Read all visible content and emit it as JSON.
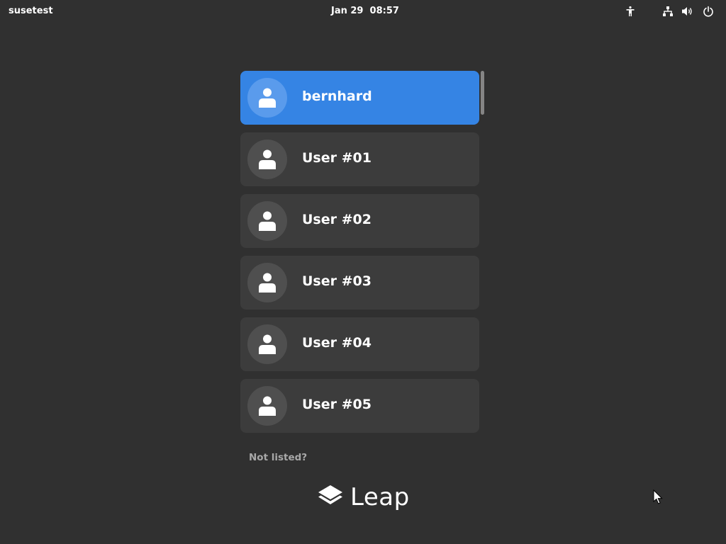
{
  "topbar": {
    "hostname": "susetest",
    "clock": "Jan 29  08:57",
    "indicators": [
      "accessibility-icon",
      "network-wired-icon",
      "volume-icon",
      "power-icon"
    ]
  },
  "users": [
    {
      "name": "bernhard",
      "selected": true
    },
    {
      "name": "User #01",
      "selected": false
    },
    {
      "name": "User #02",
      "selected": false
    },
    {
      "name": "User #03",
      "selected": false
    },
    {
      "name": "User #04",
      "selected": false
    },
    {
      "name": "User #05",
      "selected": false
    }
  ],
  "not_listed_label": "Not listed?",
  "logo": {
    "icon": "leap-layers-icon",
    "text": "Leap"
  },
  "colors": {
    "background": "#303030",
    "selected": "#3584e4",
    "item": "#3c3c3c"
  }
}
